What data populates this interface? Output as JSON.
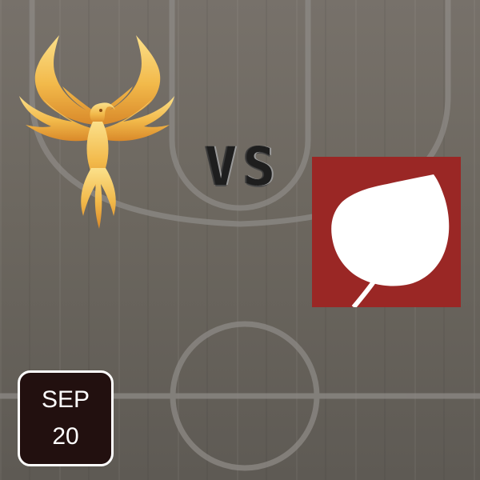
{
  "background": {
    "surface": "basketball-court-floor",
    "floor_color": "#6f6a63",
    "line_color": "#8d8a86"
  },
  "matchup": {
    "home_logo": {
      "icon": "phoenix-icon",
      "color": "#f2b94a"
    },
    "separator": "VS",
    "away_logo": {
      "icon": "aspen-leaf-icon",
      "color": "#9a2725"
    }
  },
  "date_badge": {
    "month": "SEP",
    "day": "20",
    "background": "#22100f",
    "border_color": "#ffffff"
  }
}
